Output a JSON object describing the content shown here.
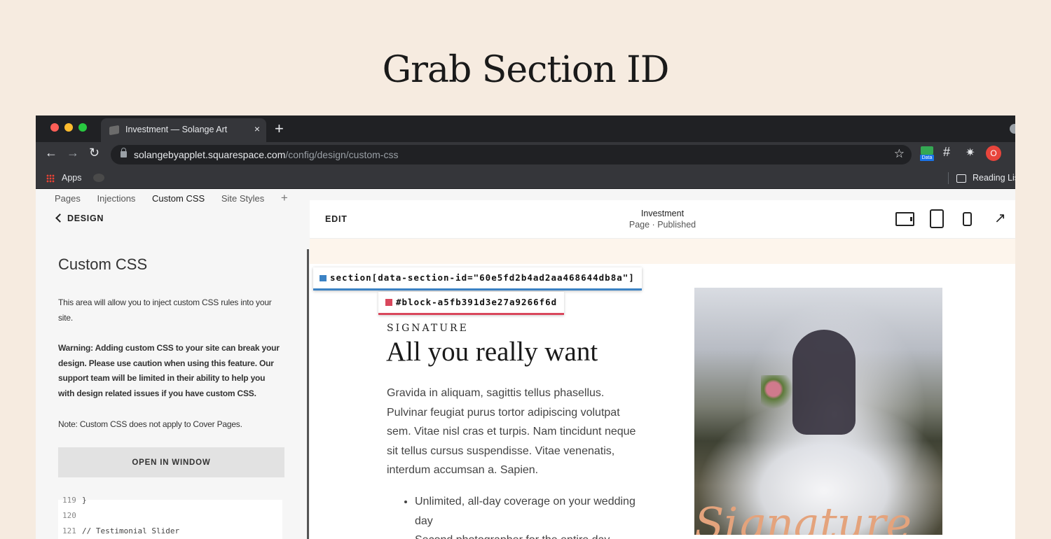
{
  "headline": "Grab Section ID",
  "browser": {
    "tab_title": "Investment — Solange Art",
    "tab_close": "×",
    "new_tab": "+",
    "url_host": "solangebyapplet.squarespace.com",
    "url_path": "/config/design/custom-css",
    "bookmark_apps": "Apps",
    "reading_list": "Reading Lis",
    "profile_initial": "O",
    "ext_data_label": "Data"
  },
  "subnav": {
    "items": [
      "Pages",
      "Injections",
      "Custom CSS",
      "Site Styles"
    ],
    "active": "Custom CSS",
    "add": "+"
  },
  "panel": {
    "back_label": "DESIGN",
    "title": "Custom CSS",
    "desc1": "This area will allow you to inject custom CSS rules into your site.",
    "warning": "Warning: Adding custom CSS to your site can break your design. Please use caution when using this feature. Our support team will be limited in their ability to help you with design related issues if you have custom CSS.",
    "note": "Note: Custom CSS does not apply to Cover Pages.",
    "open_button": "OPEN IN WINDOW",
    "code_lines": [
      {
        "n": "119",
        "text": "}"
      },
      {
        "n": "120",
        "text": ""
      },
      {
        "n": "121",
        "text": "// Testimonial Slider"
      }
    ]
  },
  "preview": {
    "edit_label": "EDIT",
    "page_name": "Investment",
    "page_status": "Page · Published",
    "section_selector": "section[data-section-id=\"60e5fd2b4ad2aa468644db8a\"]",
    "block_selector": "#block-a5fb391d3e27a9266f6d",
    "eyebrow": "SIGNATURE",
    "heading": "All you really want",
    "body": "Gravida in aliquam, sagittis tellus phasellus. Pulvinar feugiat purus tortor adipiscing volutpat sem. Vitae nisl cras et turpis. Nam tincidunt neque sit tellus cursus suspendisse. Vitae venenatis, interdum accumsan a. Sapien.",
    "bullets": [
      "Unlimited, all-day coverage on your wedding day",
      "Second photographer for the entire day"
    ],
    "photo_script": "Signature"
  },
  "colors": {
    "background": "#f6ebe0",
    "section_tag": "#3b82c4",
    "block_tag": "#d9475c"
  }
}
